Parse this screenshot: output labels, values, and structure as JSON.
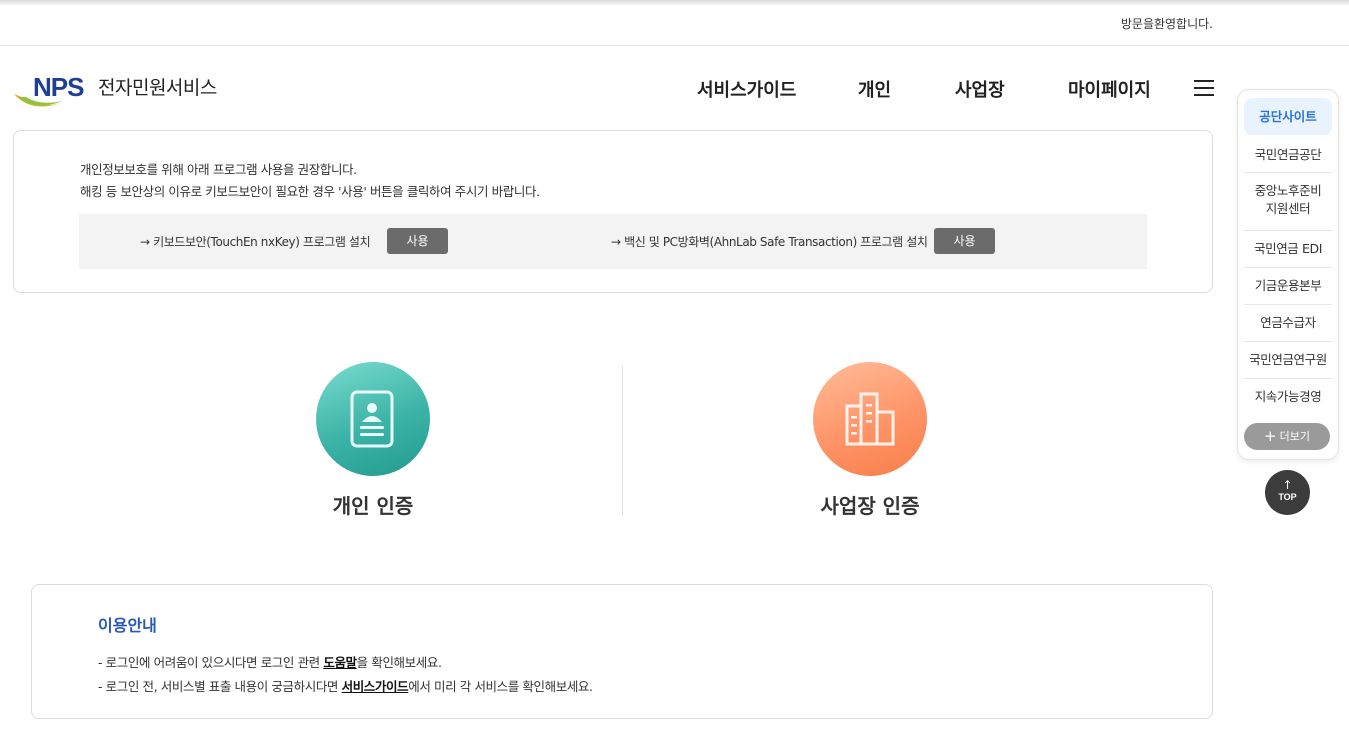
{
  "header": {
    "welcome": "방문을환영합니다.",
    "logo_text": "NPS",
    "site_title": "전자민원서비스"
  },
  "nav": {
    "items": [
      "서비스가이드",
      "개인",
      "사업장",
      "마이페이지"
    ]
  },
  "security": {
    "line1": "개인정보보호를 위해 아래 프로그램 사용을 권장합니다.",
    "line2": "해킹 등 보안상의 이유로 키보드보안이 필요한 경우 '사용' 버튼을 클릭하여 주시기 바랍니다.",
    "programs": [
      {
        "label": "→ 키보드보안(TouchEn nxKey) 프로그램 설치",
        "button": "사용"
      },
      {
        "label": "→ 백신 및 PC방화벽(AhnLab Safe Transaction) 프로그램 설치",
        "button": "사용"
      }
    ]
  },
  "auth": {
    "personal_label": "개인 인증",
    "business_label": "사업장 인증"
  },
  "guide": {
    "title": "이용안내",
    "line1_before": "- 로그인에 어려움이 있으시다면 로그인 관련 ",
    "line1_link": "도움말",
    "line1_after": "을 확인해보세요.",
    "line2_before": "- 로그인 전, 서비스별 표출 내용이 궁금하시다면 ",
    "line2_link": "서비스가이드",
    "line2_after": "에서 미리 각 서비스를 확인해보세요."
  },
  "quick_menu": {
    "title": "공단사이트",
    "items": [
      "국민연금공단",
      "중앙노후준비\n지원센터",
      "국민연금 EDI",
      "기금운용본부",
      "연금수급자",
      "국민연금연구원",
      "지속가능경영"
    ],
    "more": "더보기",
    "top": "TOP"
  },
  "colors": {
    "brand_blue": "#1f3f94",
    "accent_blue": "#2a59b4",
    "teal": "#3bb3a6",
    "orange": "#ff9468",
    "button_gray": "#6b6b6b"
  }
}
